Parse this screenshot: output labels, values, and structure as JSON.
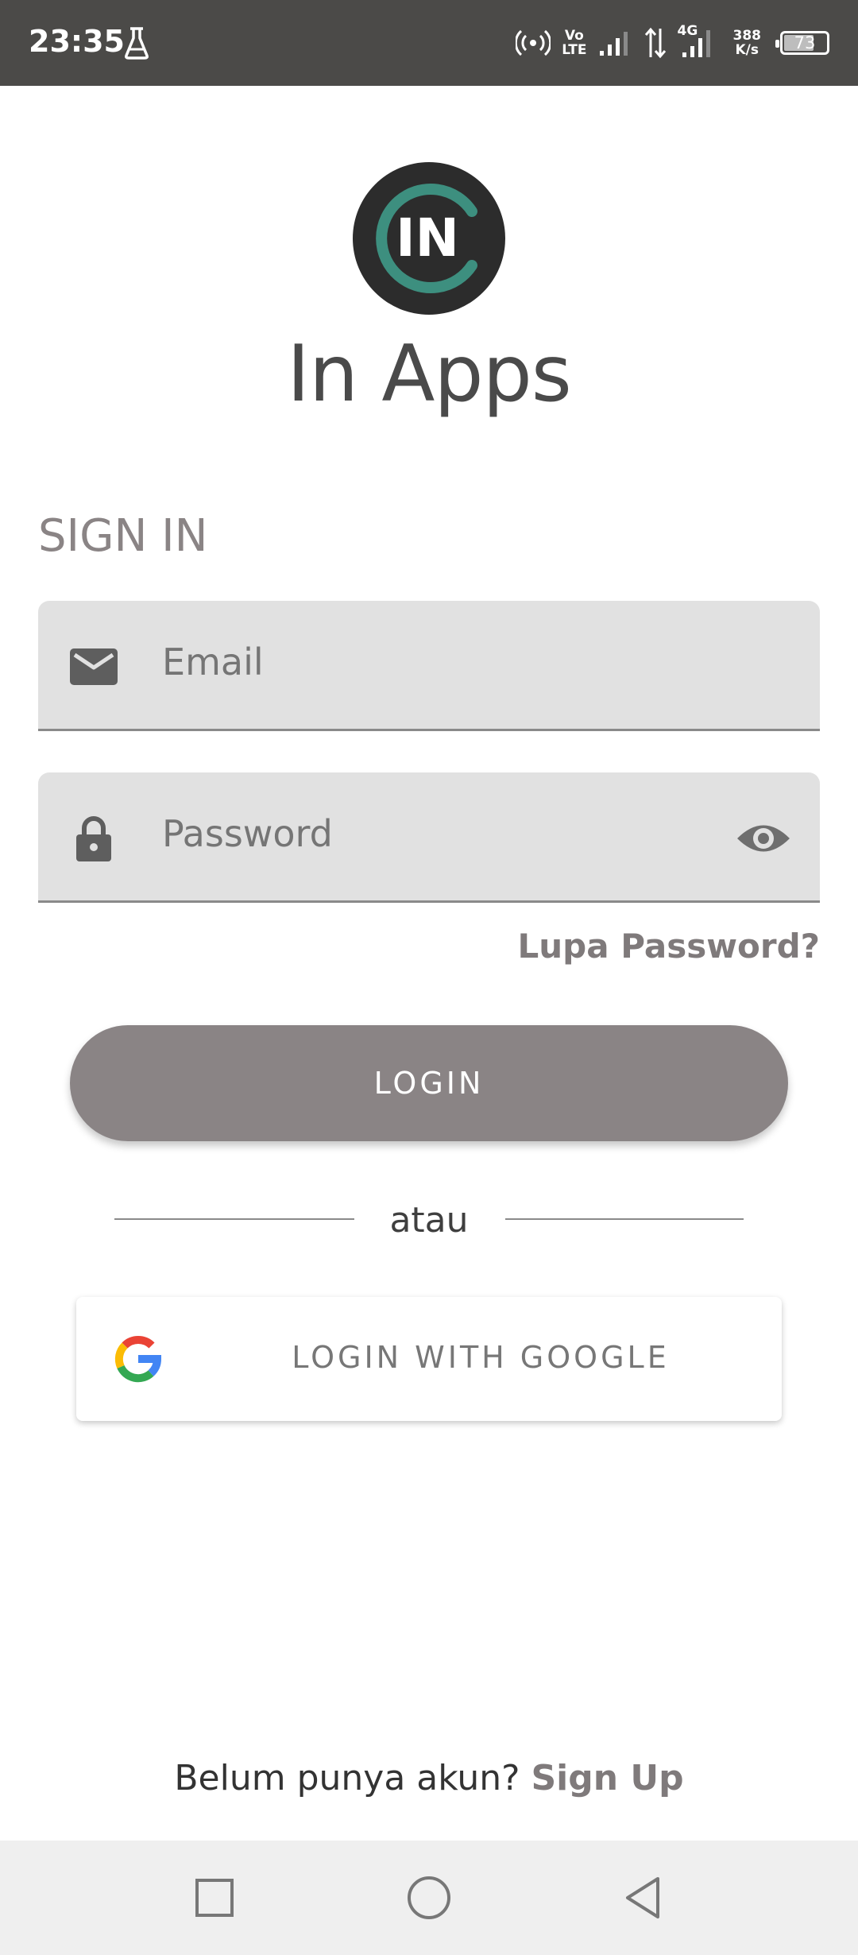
{
  "status_bar": {
    "time": "23:35",
    "volte_top": "Vo",
    "volte_bottom": "LTE",
    "network": "4G",
    "speed_value": "388",
    "speed_unit": "K/s",
    "battery": "73",
    "battery_level": 0.73,
    "icons": [
      "lab-flask-icon",
      "hotspot-icon",
      "signal-icon",
      "data-arrows-icon",
      "signal-icon",
      "battery-icon"
    ]
  },
  "app": {
    "logo_text": "IN",
    "name": "In Apps"
  },
  "form": {
    "title": "SIGN IN",
    "email_placeholder": "Email",
    "password_placeholder": "Password",
    "forgot_label": "Lupa Password?",
    "login_label": "LOGIN",
    "divider_text": "atau",
    "google_label": "LOGIN WITH GOOGLE"
  },
  "footer": {
    "prompt": "Belum punya akun? ",
    "signup_label": "Sign Up"
  },
  "colors": {
    "accent": "#8a8485",
    "logo_ring": "#3d8f7f",
    "field_bg": "#e1e1e1",
    "status_bar": "#4b4a48"
  }
}
